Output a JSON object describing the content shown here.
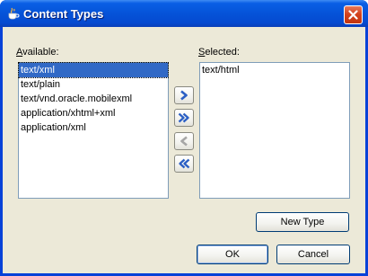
{
  "window": {
    "title": "Content Types",
    "close_icon": "close-icon",
    "app_icon": "java-cup-icon"
  },
  "available": {
    "label": "Available:",
    "items": [
      "text/xml",
      "text/plain",
      "text/vnd.oracle.mobilexml",
      "application/xhtml+xml",
      "application/xml"
    ],
    "selected_index": 0
  },
  "selected": {
    "label": "Selected:",
    "items": [
      "text/html"
    ]
  },
  "move_buttons": {
    "add": "chevron-right-icon",
    "add_all": "double-chevron-right-icon",
    "remove": "chevron-left-icon",
    "remove_all": "double-chevron-left-icon"
  },
  "buttons": {
    "new_type": "New Type",
    "ok": "OK",
    "cancel": "Cancel"
  },
  "colors": {
    "titlebar": "#0553d8",
    "dialog_bg": "#ece9d8",
    "selection": "#3169c6",
    "arrow_enabled": "#2b5fc4",
    "arrow_disabled": "#a6a6a6"
  }
}
